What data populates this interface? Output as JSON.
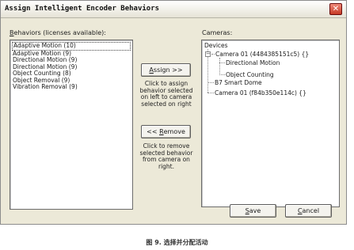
{
  "window": {
    "title": "Assign Intelligent Encoder Behaviors",
    "close_glyph": "✕"
  },
  "behaviors": {
    "label_prefix": "",
    "label_hotkey": "B",
    "label_rest": "ehaviors (licenses available):",
    "items": [
      "Adaptive Motion (10)",
      "Adaptive Motion (9)",
      "Directional Motion (9)",
      "Directional Motion (9)",
      "Object Counting (8)",
      "Object Removal (9)",
      "Vibration Removal (9)"
    ]
  },
  "assign": {
    "hotkey": "A",
    "rest": "ssign >>",
    "help": [
      "Click to assign",
      "behavior selected",
      "on left to camera",
      "selected on right"
    ]
  },
  "remove": {
    "prefix": "<< ",
    "hotkey": "R",
    "rest": "emove",
    "help": [
      "Click to remove",
      "selected behavior",
      "from camera on",
      "right."
    ]
  },
  "cameras": {
    "label": "Cameras:",
    "root": "Devices",
    "expander": "−",
    "camera1": "Camera 01 (4484385151c5) {}",
    "camera1_children": [
      "Directional Motion",
      "Object Counting"
    ],
    "camera2": "B7 Smart Dome",
    "camera3": "Camera 01 (f84b350e114c) {}"
  },
  "save": {
    "hotkey": "S",
    "rest": "ave"
  },
  "cancel": {
    "hotkey": "C",
    "rest": "ancel"
  },
  "caption": "图 9. 选择并分配活动"
}
